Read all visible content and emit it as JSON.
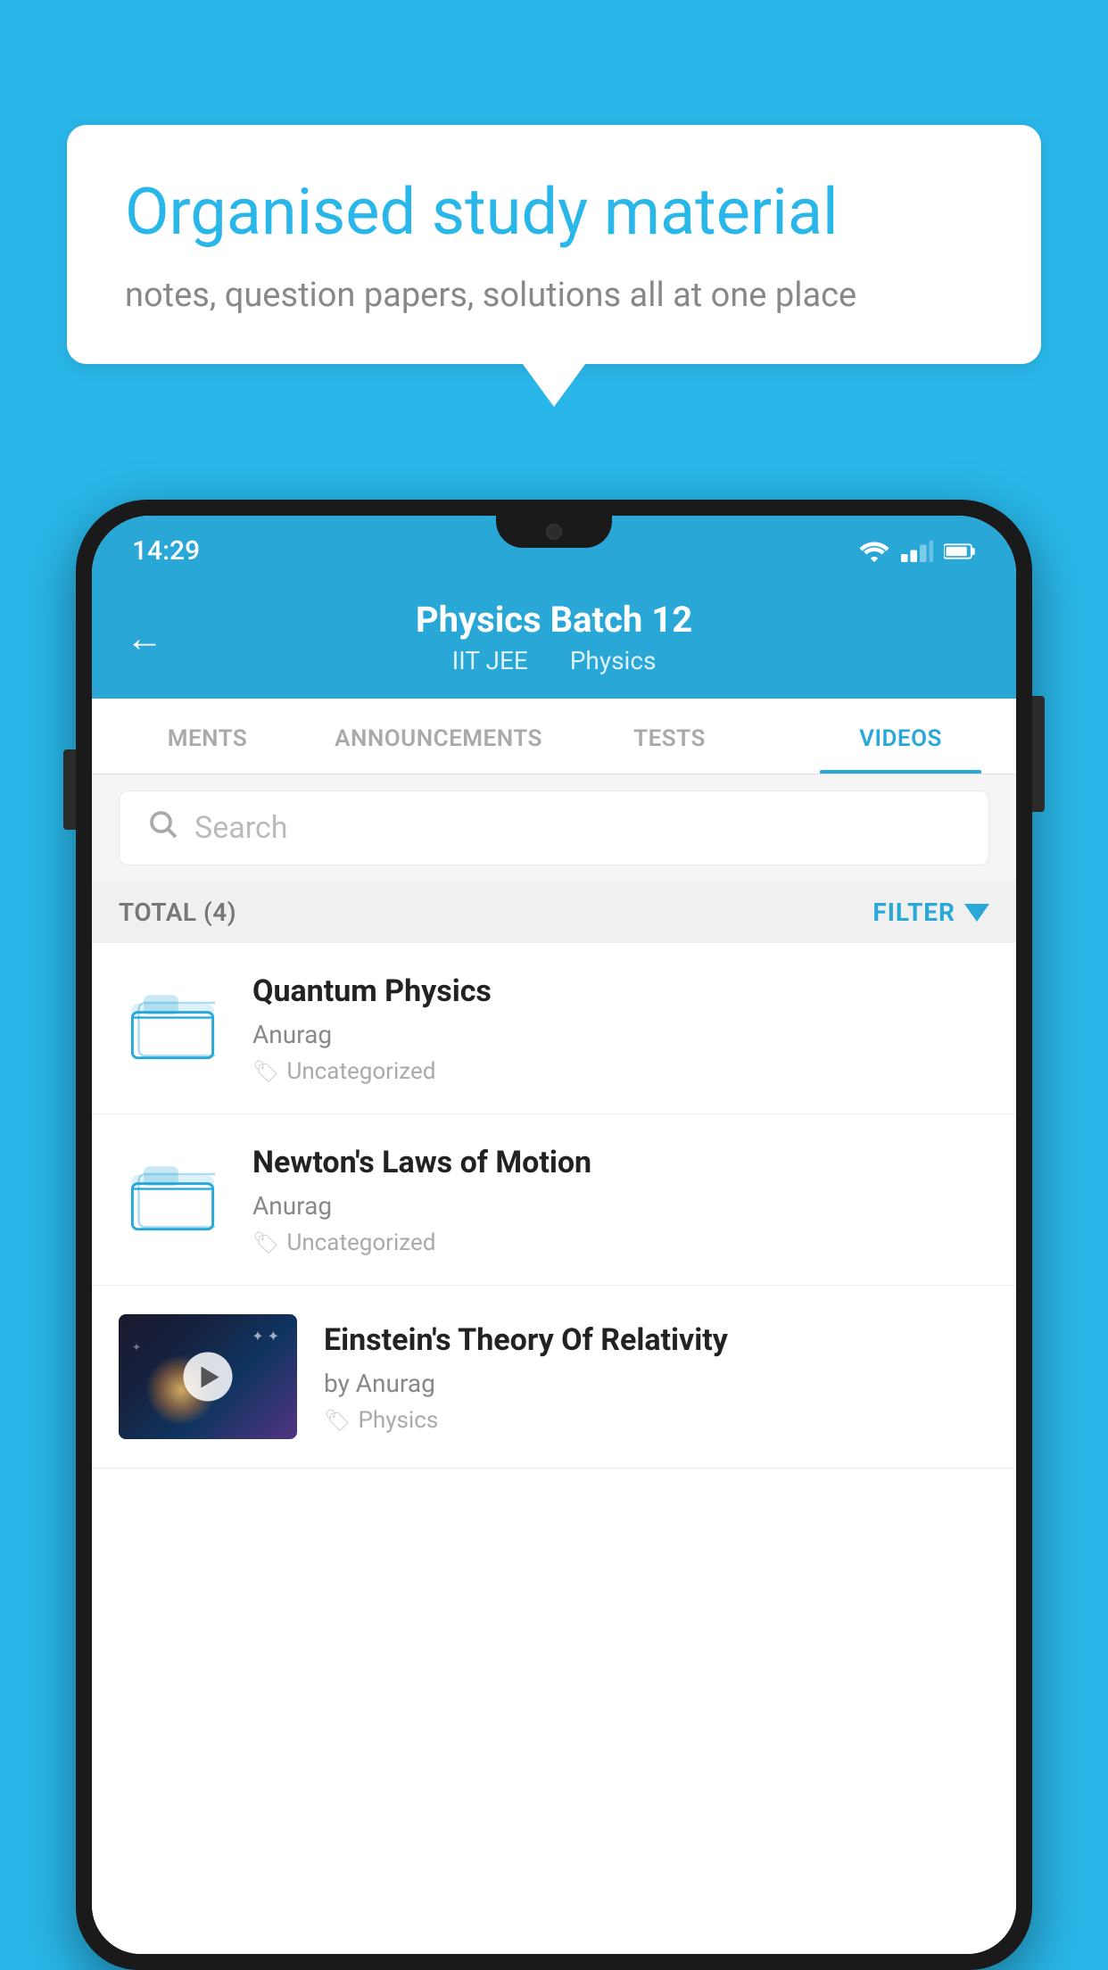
{
  "background_color": "#29b6e8",
  "bubble": {
    "title": "Organised study material",
    "subtitle": "notes, question papers, solutions all at one place"
  },
  "phone": {
    "status_bar": {
      "time": "14:29",
      "wifi": true,
      "signal": true,
      "battery": true
    },
    "header": {
      "title": "Physics Batch 12",
      "subtitle_parts": [
        "IIT JEE",
        "Physics"
      ],
      "back_arrow": "←"
    },
    "tabs": [
      {
        "label": "MENTS",
        "active": false
      },
      {
        "label": "ANNOUNCEMENTS",
        "active": false
      },
      {
        "label": "TESTS",
        "active": false
      },
      {
        "label": "VIDEOS",
        "active": true
      }
    ],
    "search": {
      "placeholder": "Search"
    },
    "filter_row": {
      "total": "TOTAL (4)",
      "filter_label": "FILTER"
    },
    "videos": [
      {
        "id": "1",
        "type": "folder",
        "title": "Quantum Physics",
        "author": "Anurag",
        "tag": "Uncategorized"
      },
      {
        "id": "2",
        "type": "folder",
        "title": "Newton's Laws of Motion",
        "author": "Anurag",
        "tag": "Uncategorized"
      },
      {
        "id": "3",
        "type": "video",
        "title": "Einstein's Theory Of Relativity",
        "author": "by Anurag",
        "tag": "Physics"
      }
    ]
  }
}
